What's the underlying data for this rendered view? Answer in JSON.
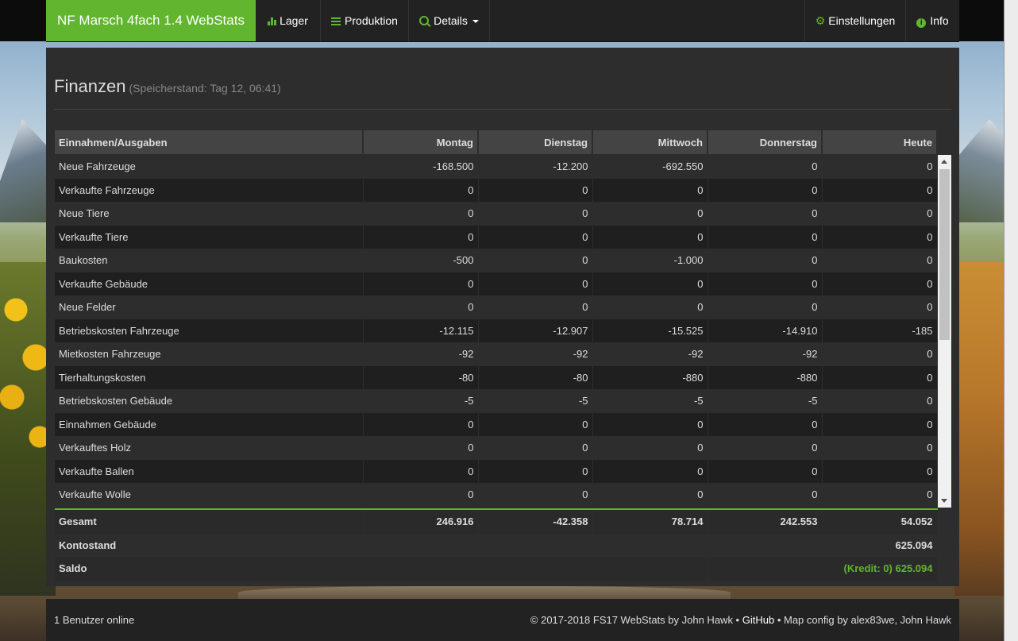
{
  "nav": {
    "brand": "NF Marsch 4fach 1.4 WebStats",
    "lager": "Lager",
    "produktion": "Produktion",
    "details": "Details",
    "einstellungen": "Einstellungen",
    "info": "Info"
  },
  "page": {
    "title": "Finanzen",
    "subtitle": "(Speicherstand: Tag 12, 06:41)"
  },
  "table": {
    "headers": [
      "Einnahmen/Ausgaben",
      "Montag",
      "Dienstag",
      "Mittwoch",
      "Donnerstag",
      "Heute"
    ],
    "rows": [
      [
        "Neue Fahrzeuge",
        "-168.500",
        "-12.200",
        "-692.550",
        "0",
        "0"
      ],
      [
        "Verkaufte Fahrzeuge",
        "0",
        "0",
        "0",
        "0",
        "0"
      ],
      [
        "Neue Tiere",
        "0",
        "0",
        "0",
        "0",
        "0"
      ],
      [
        "Verkaufte Tiere",
        "0",
        "0",
        "0",
        "0",
        "0"
      ],
      [
        "Baukosten",
        "-500",
        "0",
        "-1.000",
        "0",
        "0"
      ],
      [
        "Verkaufte Gebäude",
        "0",
        "0",
        "0",
        "0",
        "0"
      ],
      [
        "Neue Felder",
        "0",
        "0",
        "0",
        "0",
        "0"
      ],
      [
        "Betriebskosten Fahrzeuge",
        "-12.115",
        "-12.907",
        "-15.525",
        "-14.910",
        "-185"
      ],
      [
        "Mietkosten Fahrzeuge",
        "-92",
        "-92",
        "-92",
        "-92",
        "0"
      ],
      [
        "Tierhaltungskosten",
        "-80",
        "-80",
        "-880",
        "-880",
        "0"
      ],
      [
        "Betriebskosten Gebäude",
        "-5",
        "-5",
        "-5",
        "-5",
        "0"
      ],
      [
        "Einnahmen Gebäude",
        "0",
        "0",
        "0",
        "0",
        "0"
      ],
      [
        "Verkauftes Holz",
        "0",
        "0",
        "0",
        "0",
        "0"
      ],
      [
        "Verkaufte Ballen",
        "0",
        "0",
        "0",
        "0",
        "0"
      ],
      [
        "Verkaufte Wolle",
        "0",
        "0",
        "0",
        "0",
        "0"
      ]
    ],
    "gesamt": [
      "Gesamt",
      "246.916",
      "-42.358",
      "78.714",
      "242.553",
      "54.052"
    ],
    "kontostand": {
      "label": "Kontostand",
      "value": "625.094"
    },
    "saldo": {
      "label": "Saldo",
      "value": "(Kredit: 0) 625.094"
    }
  },
  "footer": {
    "users": "1 Benutzer online",
    "copyright": "© 2017-2018 FS17 WebStats by John Hawk •",
    "github": "GitHub",
    "mapconfig": "• Map config by alex83we, John Hawk"
  },
  "colors": {
    "accent": "#62b52e",
    "panel": "#2d2d2d",
    "navbar": "#222222"
  }
}
